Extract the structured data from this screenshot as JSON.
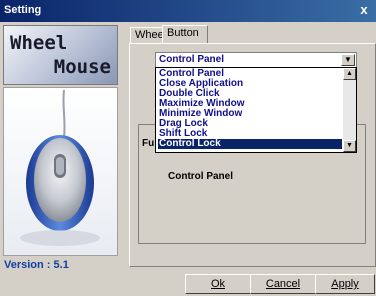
{
  "window": {
    "title": "Setting",
    "close_label": "x"
  },
  "logo": {
    "line1": "Wheel",
    "line2": "Mouse"
  },
  "version": "Version : 5.1",
  "tabs": [
    {
      "label": "Wheel"
    },
    {
      "label": "Button"
    }
  ],
  "combo": {
    "selected": "Control Panel"
  },
  "dropdown": {
    "items": [
      "Control Panel",
      "Close Application",
      "Double Click",
      "Maximize Window",
      "Minimize Window",
      "Drag Lock",
      "Shift Lock",
      "Control Lock"
    ],
    "highlighted_index": 7
  },
  "function_label": "Fu",
  "function_value": "Control Panel",
  "buttons": {
    "ok": "Ok",
    "cancel": "Cancel",
    "apply": "Apply"
  }
}
